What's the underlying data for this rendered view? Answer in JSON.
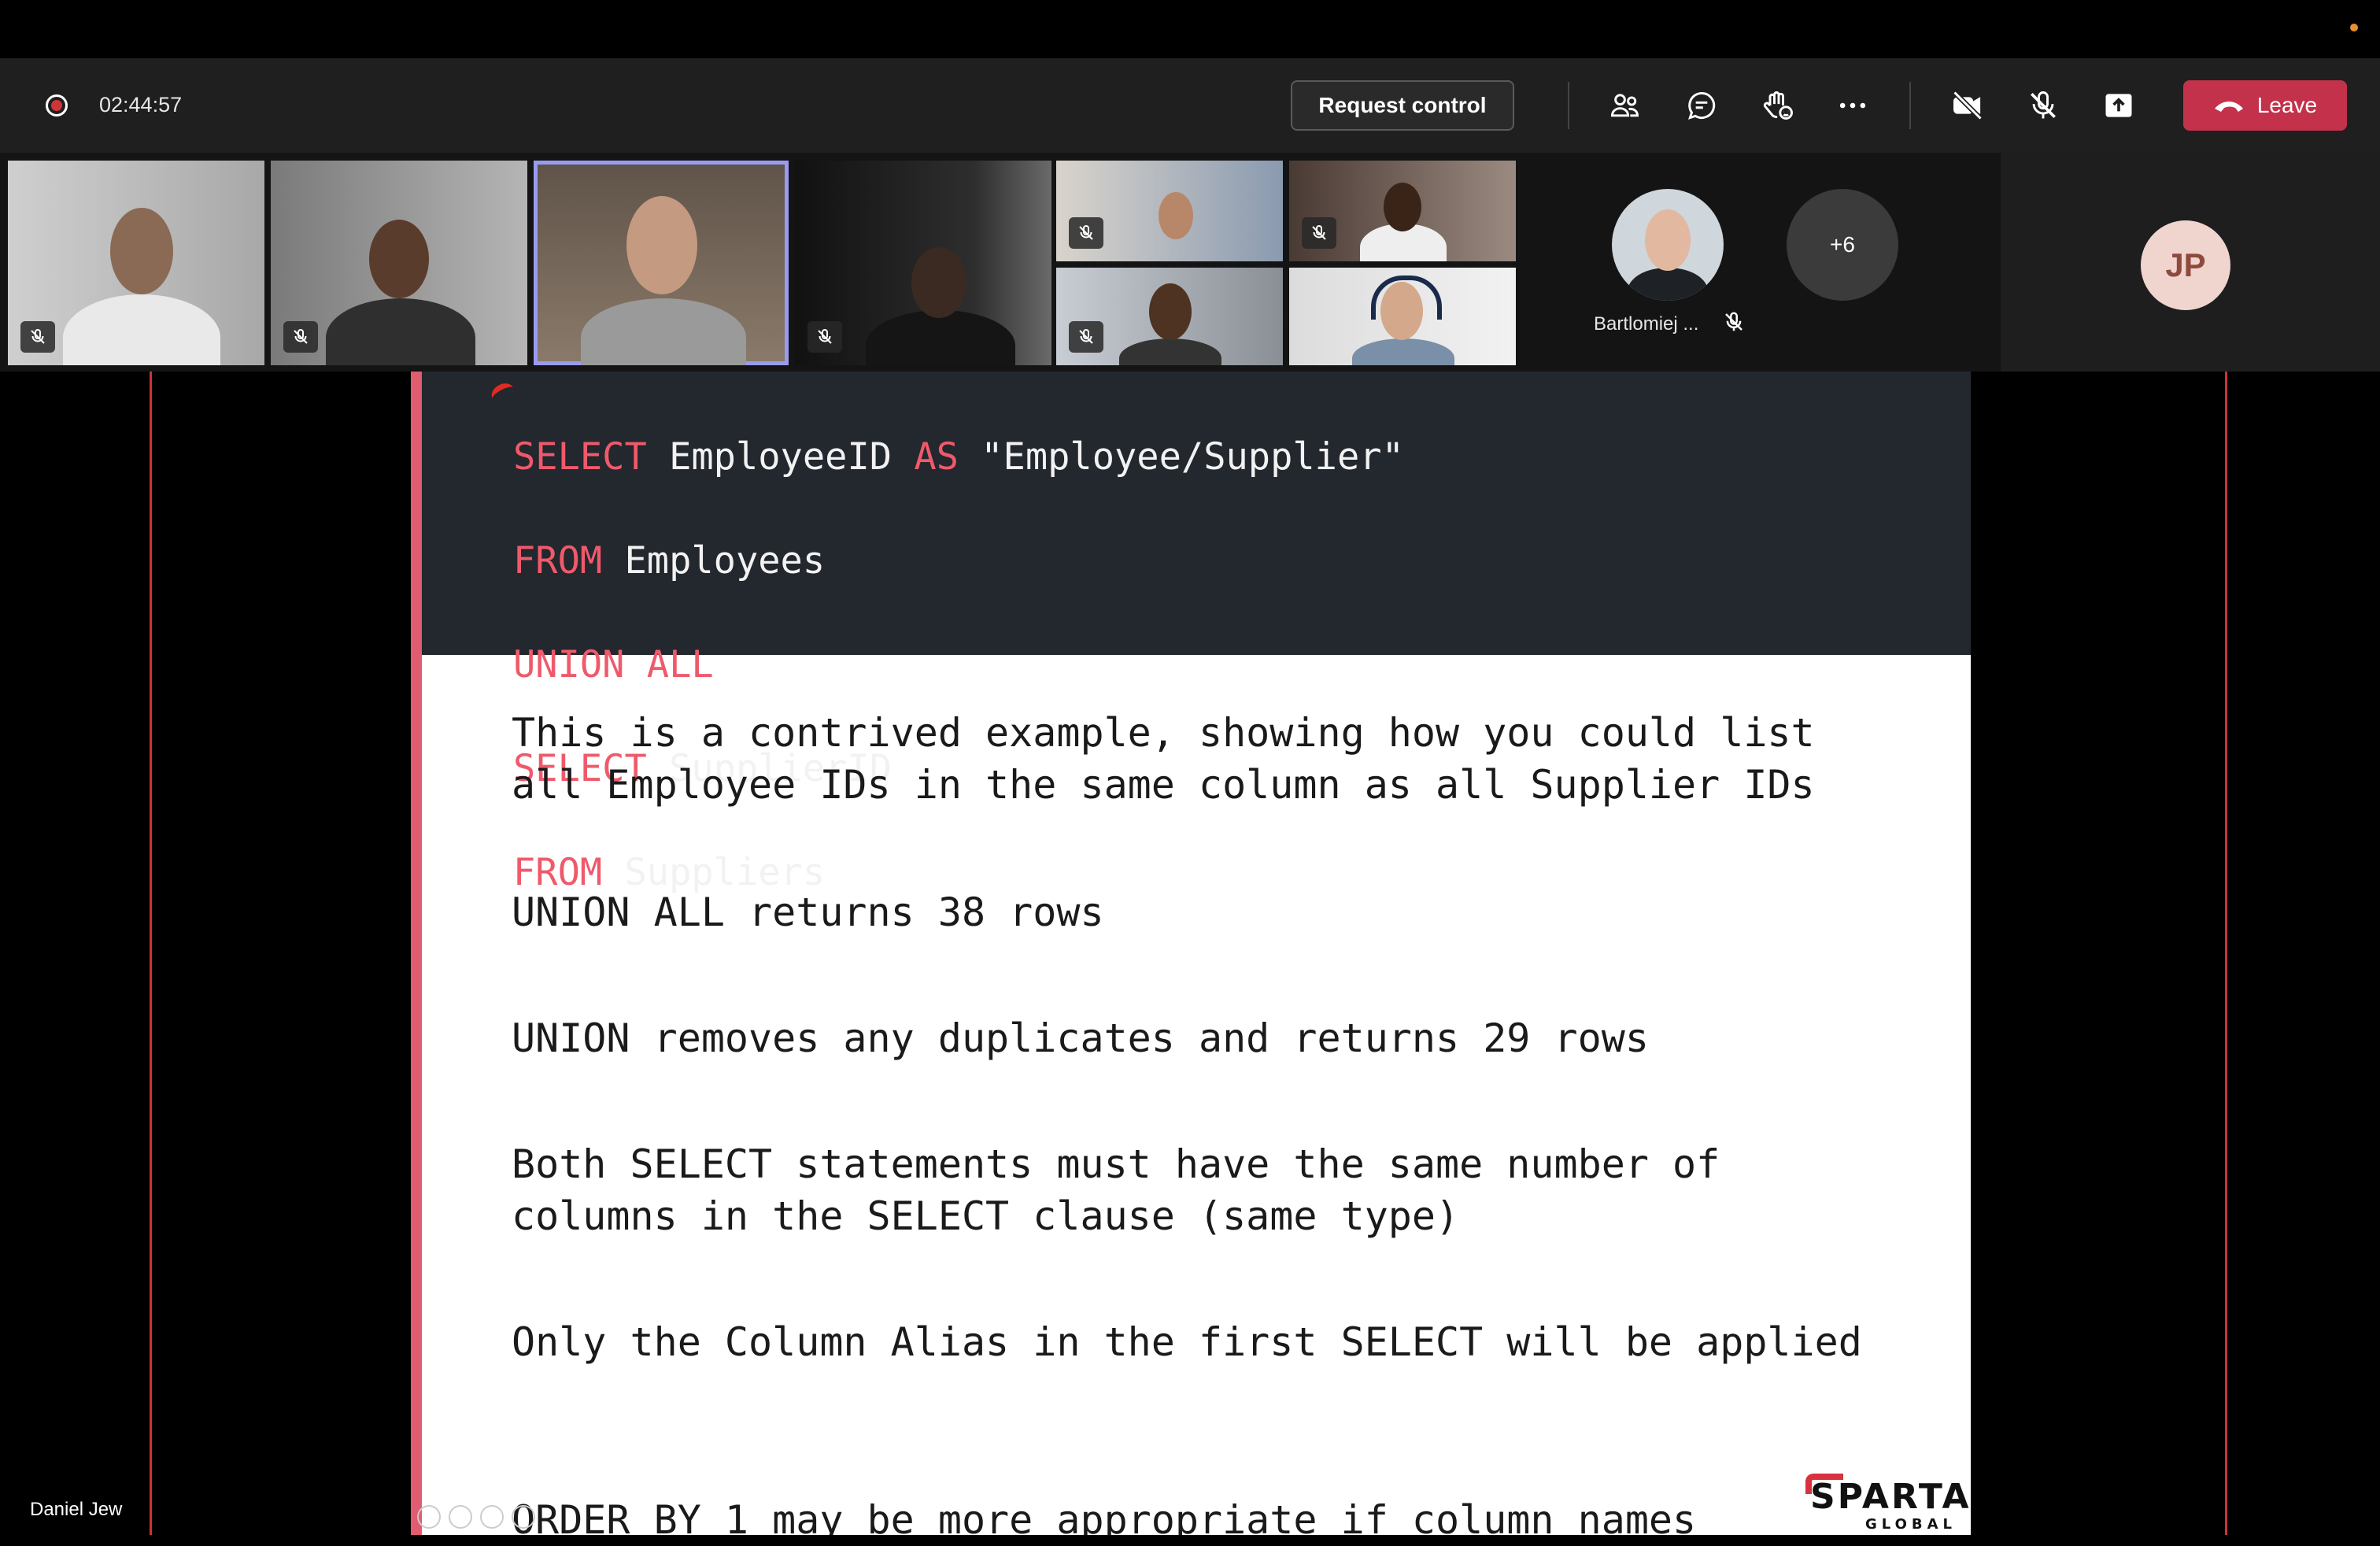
{
  "meeting": {
    "timer": "02:44:57",
    "request_control_label": "Request control",
    "leave_label": "Leave"
  },
  "roster": {
    "featured_name": "Bartlomiej ...",
    "more_count": "+6",
    "self_initials": "JP"
  },
  "presenter_name": "Daniel Jew",
  "slide": {
    "code_lines": [
      {
        "kw": "SELECT",
        "rest": " EmployeeID ",
        "kw2": "AS",
        "rest2": " \"Employee/Supplier\""
      },
      {
        "kw": "FROM",
        "rest": " Employees",
        "kw2": "",
        "rest2": ""
      },
      {
        "kw": "UNION ALL",
        "rest": "",
        "kw2": "",
        "rest2": ""
      },
      {
        "kw": "SELECT",
        "rest": " SupplierID",
        "kw2": "",
        "rest2": ""
      },
      {
        "kw": "FROM",
        "rest": " Suppliers",
        "kw2": "",
        "rest2": ""
      }
    ],
    "paragraphs": [
      "This is a contrived example, showing how you could list all Employee IDs in the same column as all Supplier IDs",
      "UNION ALL returns 38 rows",
      "UNION removes any duplicates and returns 29 rows",
      "Both SELECT statements must have the same number of columns in the SELECT clause (same type)",
      "Only the Column Alias in the first SELECT will be applied",
      "ORDER BY 1 may be more appropriate if column names"
    ],
    "logo_text": "SPARTA",
    "logo_subtext": "GLOBAL"
  },
  "colors": {
    "leave": "#c4314b",
    "keyword": "#ef5a6b",
    "active_tile": "#9a9bf0"
  }
}
